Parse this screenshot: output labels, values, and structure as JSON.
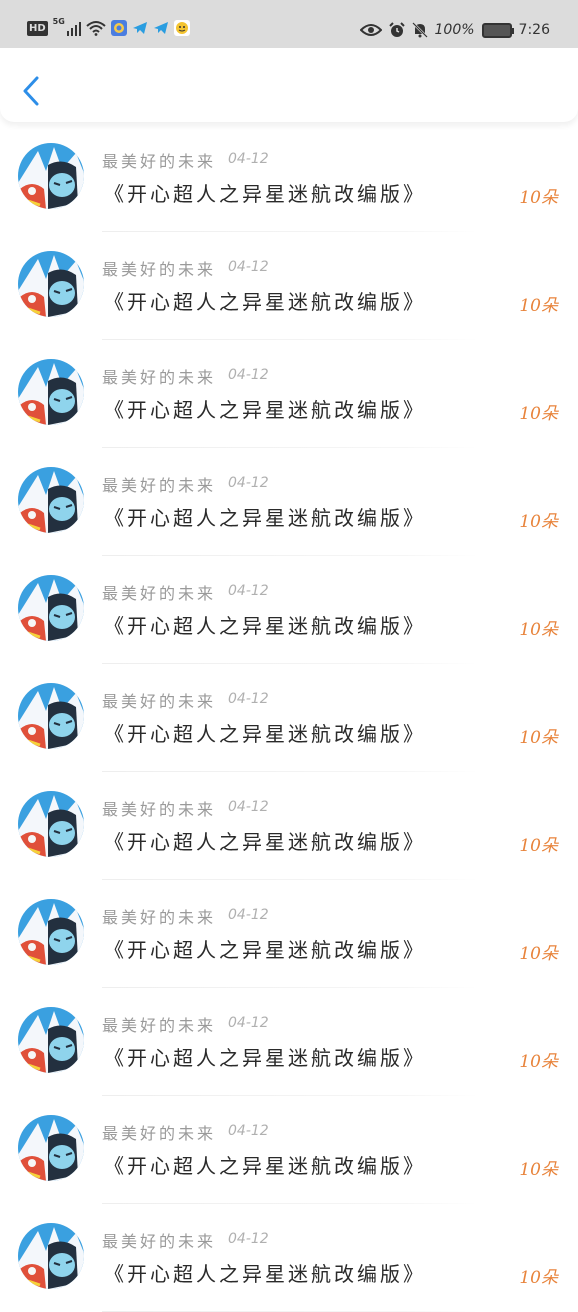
{
  "status_bar": {
    "hd": "HD",
    "network": "5G",
    "battery_pct": "100%",
    "time": "7:26",
    "icons": [
      "hd-icon",
      "signal-icon",
      "wifi-icon",
      "app-icon",
      "telegram-icon",
      "telegram-icon",
      "emoji-app-icon",
      "eye-icon",
      "alarm-icon",
      "bell-off-icon",
      "battery-icon"
    ]
  },
  "header": {
    "back_icon": "chevron-left-icon",
    "accent_color": "#2d8ee8"
  },
  "items": [
    {
      "author": "最美好的未来",
      "date": "04-12",
      "title": "《开心超人之异星迷航改编版》",
      "reward": "10朵"
    },
    {
      "author": "最美好的未来",
      "date": "04-12",
      "title": "《开心超人之异星迷航改编版》",
      "reward": "10朵"
    },
    {
      "author": "最美好的未来",
      "date": "04-12",
      "title": "《开心超人之异星迷航改编版》",
      "reward": "10朵"
    },
    {
      "author": "最美好的未来",
      "date": "04-12",
      "title": "《开心超人之异星迷航改编版》",
      "reward": "10朵"
    },
    {
      "author": "最美好的未来",
      "date": "04-12",
      "title": "《开心超人之异星迷航改编版》",
      "reward": "10朵"
    },
    {
      "author": "最美好的未来",
      "date": "04-12",
      "title": "《开心超人之异星迷航改编版》",
      "reward": "10朵"
    },
    {
      "author": "最美好的未来",
      "date": "04-12",
      "title": "《开心超人之异星迷航改编版》",
      "reward": "10朵"
    },
    {
      "author": "最美好的未来",
      "date": "04-12",
      "title": "《开心超人之异星迷航改编版》",
      "reward": "10朵"
    },
    {
      "author": "最美好的未来",
      "date": "04-12",
      "title": "《开心超人之异星迷航改编版》",
      "reward": "10朵"
    },
    {
      "author": "最美好的未来",
      "date": "04-12",
      "title": "《开心超人之异星迷航改编版》",
      "reward": "10朵"
    },
    {
      "author": "最美好的未来",
      "date": "04-12",
      "title": "《开心超人之异星迷航改编版》",
      "reward": "10朵"
    }
  ],
  "colors": {
    "reward": "#e8843c",
    "author": "#9a9a9a",
    "date": "#b0b0b0",
    "title": "#2a2a2a",
    "status_bar_bg": "#dcdcdc"
  }
}
